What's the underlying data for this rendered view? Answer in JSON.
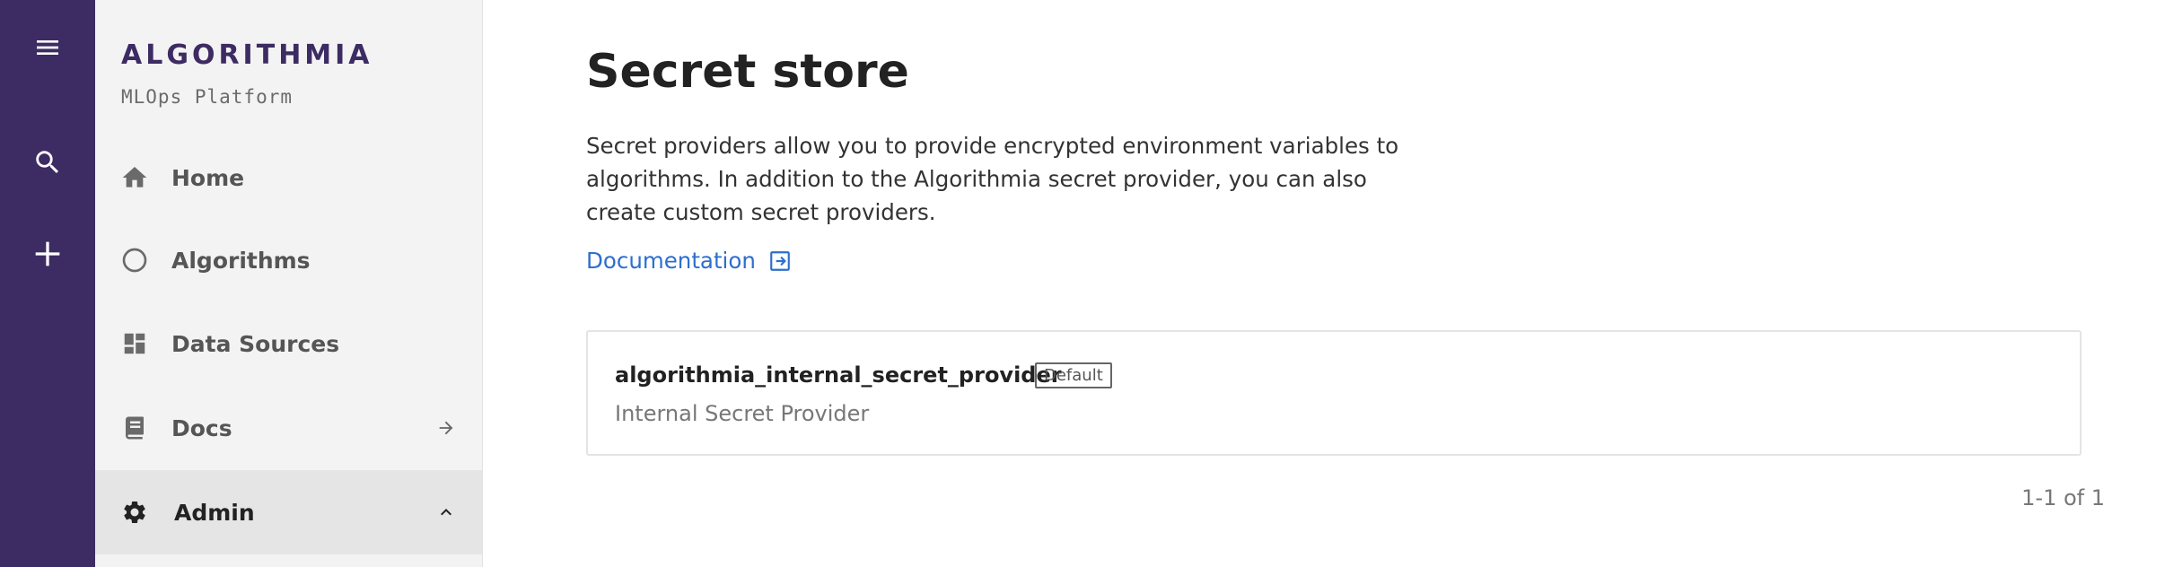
{
  "rail": {
    "icons": [
      "menu-icon",
      "search-icon",
      "add-icon"
    ]
  },
  "sidebar": {
    "logo": "ALGORITHMIA",
    "tagline": "MLOps Platform",
    "items": [
      {
        "label": "Home",
        "icon": "home-icon"
      },
      {
        "label": "Algorithms",
        "icon": "circle-icon"
      },
      {
        "label": "Data Sources",
        "icon": "dashboard-icon"
      },
      {
        "label": "Docs",
        "icon": "book-icon",
        "trail": "arrow-right-icon"
      },
      {
        "label": "Admin",
        "icon": "gear-icon",
        "trail": "chevron-up-icon",
        "active": true
      }
    ]
  },
  "main": {
    "title": "Secret store",
    "description": "Secret providers allow you to provide encrypted environment variables to algorithms. In addition to the Algorithmia secret provider, you can also create custom secret providers.",
    "doc_link": "Documentation",
    "providers": [
      {
        "name": "algorithmia_internal_secret_provider",
        "badge": "Default",
        "description": "Internal Secret Provider"
      }
    ],
    "pagination": "1-1 of 1"
  },
  "colors": {
    "rail_bg": "#3d2b63",
    "sidebar_bg": "#f3f3f3",
    "link": "#2d6fce",
    "active_item_bg": "#e5e5e5"
  }
}
